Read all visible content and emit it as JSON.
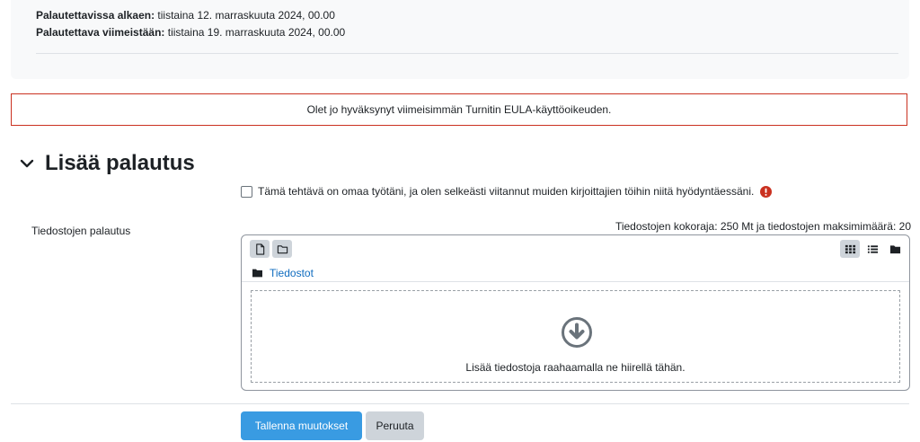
{
  "dates": {
    "allow_label": "Palautettavissa alkaen:",
    "allow_value": "tiistaina 12. marraskuuta 2024, 00.00",
    "due_label": "Palautettava viimeistään:",
    "due_value": "tiistaina 19. marraskuuta 2024, 00.00"
  },
  "eula": {
    "message": "Olet jo hyväksynyt viimeisimmän Turnitin EULA-käyttöoikeuden."
  },
  "section": {
    "title": "Lisää palautus",
    "icon": "chevron-down-icon"
  },
  "statement": {
    "text": "Tämä tehtävä on omaa työtäni, ja olen selkeästi viitannut muiden kirjoittajien töihin niitä hyödyntäessäni.",
    "checked": false,
    "required_color": "#ca3120"
  },
  "file_submission": {
    "label": "Tiedostojen palautus",
    "limits": "Tiedostojen kokoraja: 250 Mt ja tiedostojen maksimimäärä: 20",
    "path_root": "Tiedostot",
    "drop_text": "Lisää tiedostoja raahaamalla ne hiirellä tähän."
  },
  "buttons": {
    "save": "Tallenna muutokset",
    "cancel": "Peruuta"
  },
  "colors": {
    "primary": "#399be2",
    "link": "#0f6cbf",
    "secondary": "#ced4da",
    "danger": "#ca3120"
  }
}
